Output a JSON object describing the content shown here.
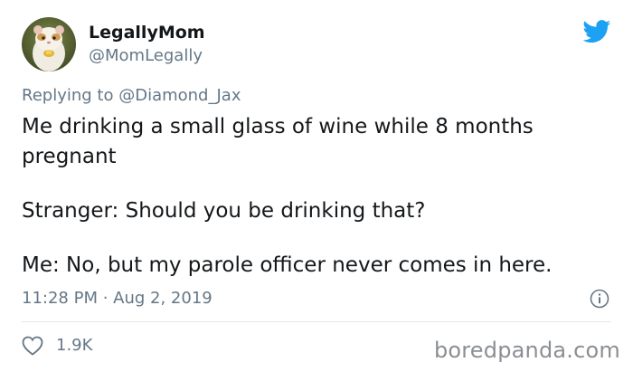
{
  "author": {
    "display_name": "LegallyMom",
    "handle": "@MomLegally",
    "avatar_icon": "hamster-avatar"
  },
  "reply": {
    "prefix": "Replying to ",
    "mention": "@Diamond_Jax"
  },
  "tweet": {
    "line1": "Me drinking a small glass of wine while 8 months pregnant",
    "line2": "Stranger: Should you be drinking that?",
    "line3": "Me: No, but my parole officer never comes in here."
  },
  "meta": {
    "timestamp": "11:28 PM · Aug 2, 2019"
  },
  "engagement": {
    "likes": "1.9K"
  },
  "watermark": "boredpanda.com",
  "colors": {
    "twitter_blue": "#1da1f2",
    "secondary_text": "#657786",
    "primary_text": "#14171a",
    "divider": "#e1e8ed"
  }
}
